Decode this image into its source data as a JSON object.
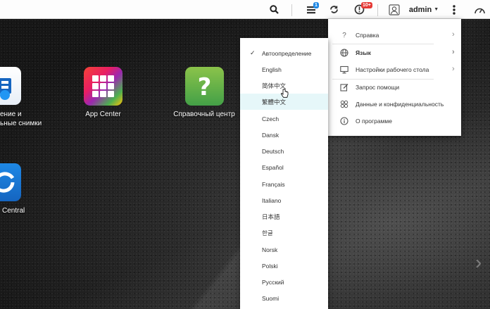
{
  "topbar": {
    "icons": {
      "search": "search-icon",
      "tasks": "tasks-icon",
      "sync": "sync-icon",
      "notifications": "notifications-icon",
      "user": "user-icon",
      "more": "more-options-icon",
      "dashboard": "dashboard-icon"
    },
    "tasks_badge": "1",
    "notifications_badge": "10+",
    "user_name": "admin",
    "badge_colors": {
      "tasks": "#1e88e5",
      "notifications": "#e53935"
    }
  },
  "desktop": {
    "apps": [
      {
        "label_line1": "ение и",
        "label_line2": "ьные снимки",
        "icon": "backup-restore-icon"
      },
      {
        "label": "App Center",
        "icon": "app-center-icon"
      },
      {
        "label": "Справочный центр",
        "icon": "help-center-icon"
      },
      {
        "label": "Central",
        "icon": "sync-central-icon"
      }
    ]
  },
  "main_menu": {
    "items": [
      {
        "label": "Справка",
        "icon": "question-icon",
        "has_submenu": true
      },
      {
        "label": "Язык",
        "icon": "globe-icon",
        "has_submenu": true,
        "active": true
      },
      {
        "label": "Настройки рабочего стола",
        "icon": "monitor-icon",
        "has_submenu": true
      },
      {
        "label": "Запрос помощи",
        "icon": "edit-icon",
        "has_submenu": false
      },
      {
        "label": "Данные и конфиденциальность",
        "icon": "privacy-icon",
        "has_submenu": false
      },
      {
        "label": "О программе",
        "icon": "info-icon",
        "has_submenu": false
      }
    ]
  },
  "language_menu": {
    "selected": "Автоопределение",
    "hovered": "繁體中文",
    "items": [
      "Автоопределение",
      "English",
      "简体中文",
      "繁體中文",
      "Czech",
      "Dansk",
      "Deutsch",
      "Español",
      "Français",
      "Italiano",
      "日本語",
      "한글",
      "Norsk",
      "Polski",
      "Русский",
      "Suomi"
    ]
  }
}
